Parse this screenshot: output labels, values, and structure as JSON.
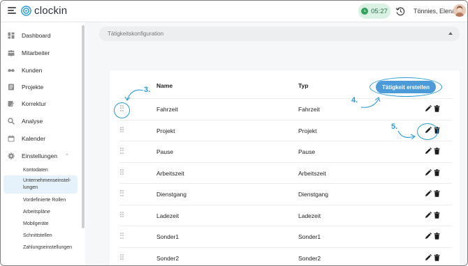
{
  "header": {
    "brand": "clockin",
    "timer": "05:27",
    "user_name": "Tönnies, Elena"
  },
  "sidebar": {
    "items": [
      {
        "label": "Dashboard",
        "icon": "dashboard-icon"
      },
      {
        "label": "Mitarbeiter",
        "icon": "employees-icon"
      },
      {
        "label": "Kunden",
        "icon": "handshake-icon"
      },
      {
        "label": "Projekte",
        "icon": "projects-icon"
      },
      {
        "label": "Korrektur",
        "icon": "correction-icon"
      },
      {
        "label": "Analyse",
        "icon": "analysis-icon"
      },
      {
        "label": "Kalender",
        "icon": "calendar-icon"
      },
      {
        "label": "Einstellungen",
        "icon": "gear-icon"
      }
    ],
    "sub_items": [
      {
        "label": "Kontodaten"
      },
      {
        "label": "Unternehmenseinstel-\nlungen"
      },
      {
        "label": "Vordefinierte Rollen"
      },
      {
        "label": "Arbeitspläne"
      },
      {
        "label": "Mobilgeräte"
      },
      {
        "label": "Schnittstellen"
      },
      {
        "label": "Zahlungseinstellungen"
      }
    ]
  },
  "main": {
    "config_label": "Tätigkeitskonfiguration",
    "columns": {
      "name": "Name",
      "type": "Typ"
    },
    "create_button": "Tätigkeit erstellen",
    "rows": [
      {
        "name": "Fahrzeit",
        "type": "Fahrzeit"
      },
      {
        "name": "Projekt",
        "type": "Projekt"
      },
      {
        "name": "Pause",
        "type": "Pause"
      },
      {
        "name": "Arbeitszeit",
        "type": "Arbeitszeit"
      },
      {
        "name": "Dienstgang",
        "type": "Dienstgang"
      },
      {
        "name": "Ladezeit",
        "type": "Ladezeit"
      },
      {
        "name": "Sonder1",
        "type": "Sonder1"
      },
      {
        "name": "Sonder2",
        "type": "Sonder2"
      }
    ]
  },
  "annotations": {
    "step3": "3.",
    "step4": "4.",
    "step5": "5."
  },
  "colors": {
    "accent": "#4c9ad8",
    "annotation": "#2a9bd3",
    "timer_bg": "#d9f2e3",
    "timer_dot": "#2fa35c",
    "active_sub_bg": "#e6f2fb"
  }
}
